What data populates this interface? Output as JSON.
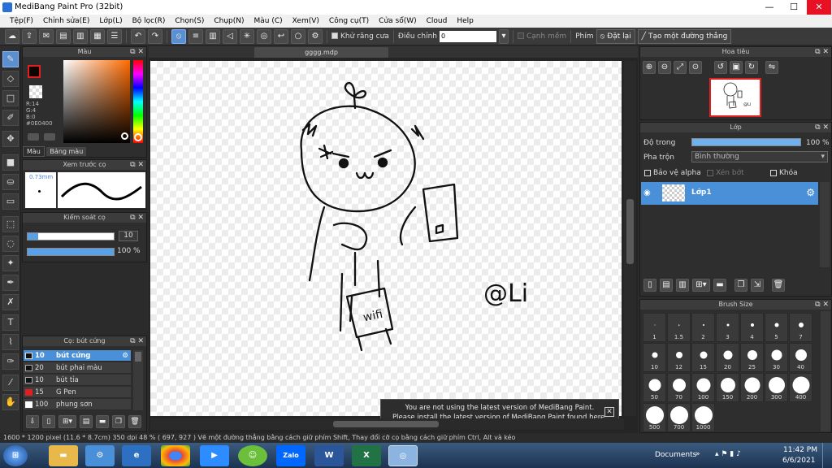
{
  "window": {
    "title": "MediBang Paint Pro (32bit)",
    "minimize": "—",
    "maximize": "☐",
    "close": "✕"
  },
  "menu": [
    "Tệp(F)",
    "Chỉnh sửa(E)",
    "Lớp(L)",
    "Bộ lọc(R)",
    "Chọn(S)",
    "Chụp(N)",
    "Màu (C)",
    "Xem(V)",
    "Công cụ(T)",
    "Cửa sổ(W)",
    "Cloud",
    "Help"
  ],
  "toolbar": {
    "antialias_label": "Khử răng cưa",
    "adjust_label": "Điều chỉnh",
    "adjust_value": "0",
    "edge_label": "Cạnh mềm",
    "key_label": "Phím",
    "reset_label": "Đặt lại",
    "straight_line_label": "Tạo một đường thẳng"
  },
  "color_panel": {
    "title": "Màu",
    "r": "R:14",
    "g": "G:4",
    "b": "B:0",
    "hex": "#0E0400",
    "tab_color": "Màu",
    "tab_palette": "Bảng màu",
    "fg_color": "#0e0400",
    "accent": "#e02020"
  },
  "preview_panel": {
    "title": "Xem trước cọ",
    "size": "0.73mm"
  },
  "brush_control": {
    "title": "Kiểm soát cọ",
    "size_value": "10",
    "opacity_value": "100 %",
    "size_fraction": 0.12,
    "opacity_fraction": 1.0
  },
  "brush_list": {
    "title": "Cọ: bút cứng",
    "items": [
      {
        "size": "10",
        "name": "bút cứng",
        "color": "#111111"
      },
      {
        "size": "20",
        "name": "bút phai màu",
        "color": "#111111"
      },
      {
        "size": "10",
        "name": "bút tỉa",
        "color": "#111111"
      },
      {
        "size": "15",
        "name": "G Pen",
        "color": "#e02020"
      },
      {
        "size": "100",
        "name": "phung sơn",
        "color": "#ffffff"
      }
    ]
  },
  "document": {
    "tab": "gggg.mdp"
  },
  "notice": {
    "line1": "You are not using the latest version of MediBang Paint.",
    "line2": "Please install the latest version of MediBang Paint found here.",
    "close": "✕"
  },
  "navigator": {
    "title": "Hoa tiêu"
  },
  "layer_panel": {
    "title": "Lớp",
    "opacity_label": "Độ trong",
    "opacity_value": "100 %",
    "blend_label": "Pha trộn",
    "blend_value": "Bình thường",
    "protect_alpha": "Bảo vệ alpha",
    "clipping": "Xén bớt",
    "lock": "Khóa",
    "layer_name": "Lớp1"
  },
  "brush_size_panel": {
    "title": "Brush Size",
    "sizes": [
      "1",
      "1.5",
      "2",
      "3",
      "4",
      "5",
      "7",
      "10",
      "12",
      "15",
      "20",
      "25",
      "30",
      "40",
      "50",
      "70",
      "100",
      "150",
      "200",
      "300",
      "400",
      "500",
      "700",
      "1000"
    ]
  },
  "status": {
    "text": "1600 * 1200 pixel   (11.6 * 8.7cm)   350 dpi   48 %   ( 697, 927 )   Vẽ một đường thẳng bằng cách giữ phím Shift, Thay đổi cỡ cọ bằng cách giữ phím Ctrl, Alt và kéo"
  },
  "taskbar": {
    "documents": "Documents",
    "time": "11:42 PM",
    "date": "6/6/2021",
    "zalo": "Zalo",
    "word": "W",
    "excel": "X"
  },
  "artwork": {
    "signature": "@Li",
    "sign_text": "wifi"
  }
}
